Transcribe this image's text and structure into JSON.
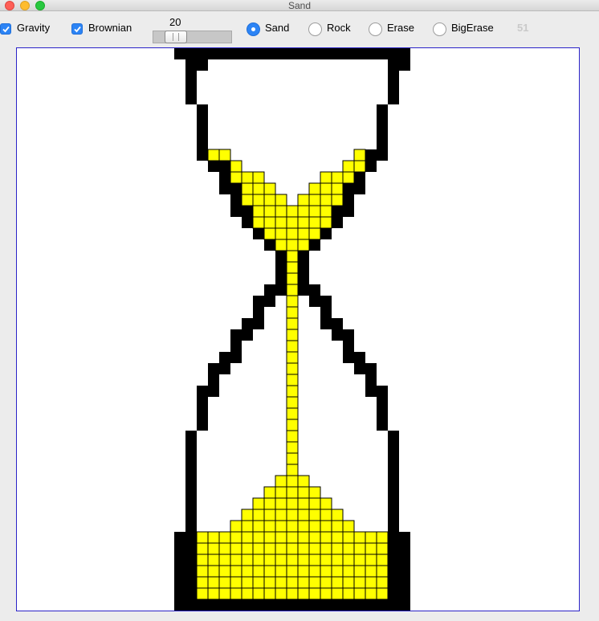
{
  "window": {
    "title": "Sand"
  },
  "toolbar": {
    "gravity": {
      "label": "Gravity",
      "checked": true
    },
    "brownian": {
      "label": "Brownian",
      "checked": true
    },
    "speed": {
      "value": "20",
      "level_percent": 20
    },
    "tools": [
      {
        "label": "Sand",
        "selected": true
      },
      {
        "label": "Rock",
        "selected": false
      },
      {
        "label": "Erase",
        "selected": false
      },
      {
        "label": "BigErase",
        "selected": false
      }
    ],
    "counter": "51"
  },
  "colors": {
    "sand": "#ffff00",
    "rock": "#000000",
    "background": "#ffffff",
    "canvas_border": "#2a22c8",
    "accent": "#2c84f5"
  },
  "icons": {
    "checkbox": "checkmark-icon",
    "radio": "radio-dot-icon"
  }
}
